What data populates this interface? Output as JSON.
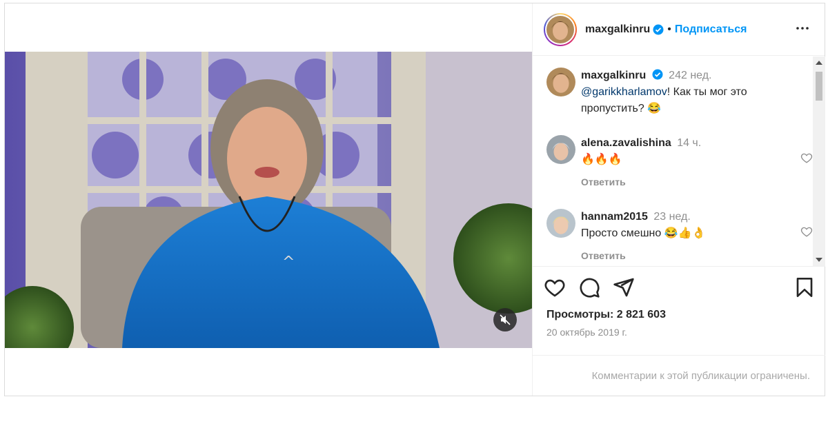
{
  "post": {
    "author": {
      "username": "maxgalkinru",
      "verified_icon": "verified-badge-icon",
      "separator": "•",
      "follow_label": "Подписаться",
      "more_icon": "more-options-icon"
    },
    "caption": {
      "username": "maxgalkinru",
      "time": "242 нед.",
      "mention": "@garikkharlamov",
      "text": "! Как ты мог это пропустить? 😂"
    },
    "comments": [
      {
        "username": "alena.zavalishina",
        "time": "14 ч.",
        "text": "🔥🔥🔥",
        "reply_label": "Ответить"
      },
      {
        "username": "hannam2015",
        "time": "23 нед.",
        "text": "Просто смешно 😂👍👌",
        "reply_label": "Ответить"
      }
    ],
    "actions": {
      "like_icon": "heart-icon",
      "comment_icon": "comment-icon",
      "share_icon": "share-icon",
      "save_icon": "bookmark-icon"
    },
    "views": "Просмотры: 2 821 603",
    "date": "20 октябрь 2019 г.",
    "restricted_text": "Комментарии к этой публикации ограничены.",
    "media": {
      "mute_icon": "speaker-muted-icon"
    }
  },
  "colors": {
    "accent": "#0095f6",
    "text": "#262626",
    "muted": "#8e8e8e",
    "border": "#dbdbdb"
  }
}
